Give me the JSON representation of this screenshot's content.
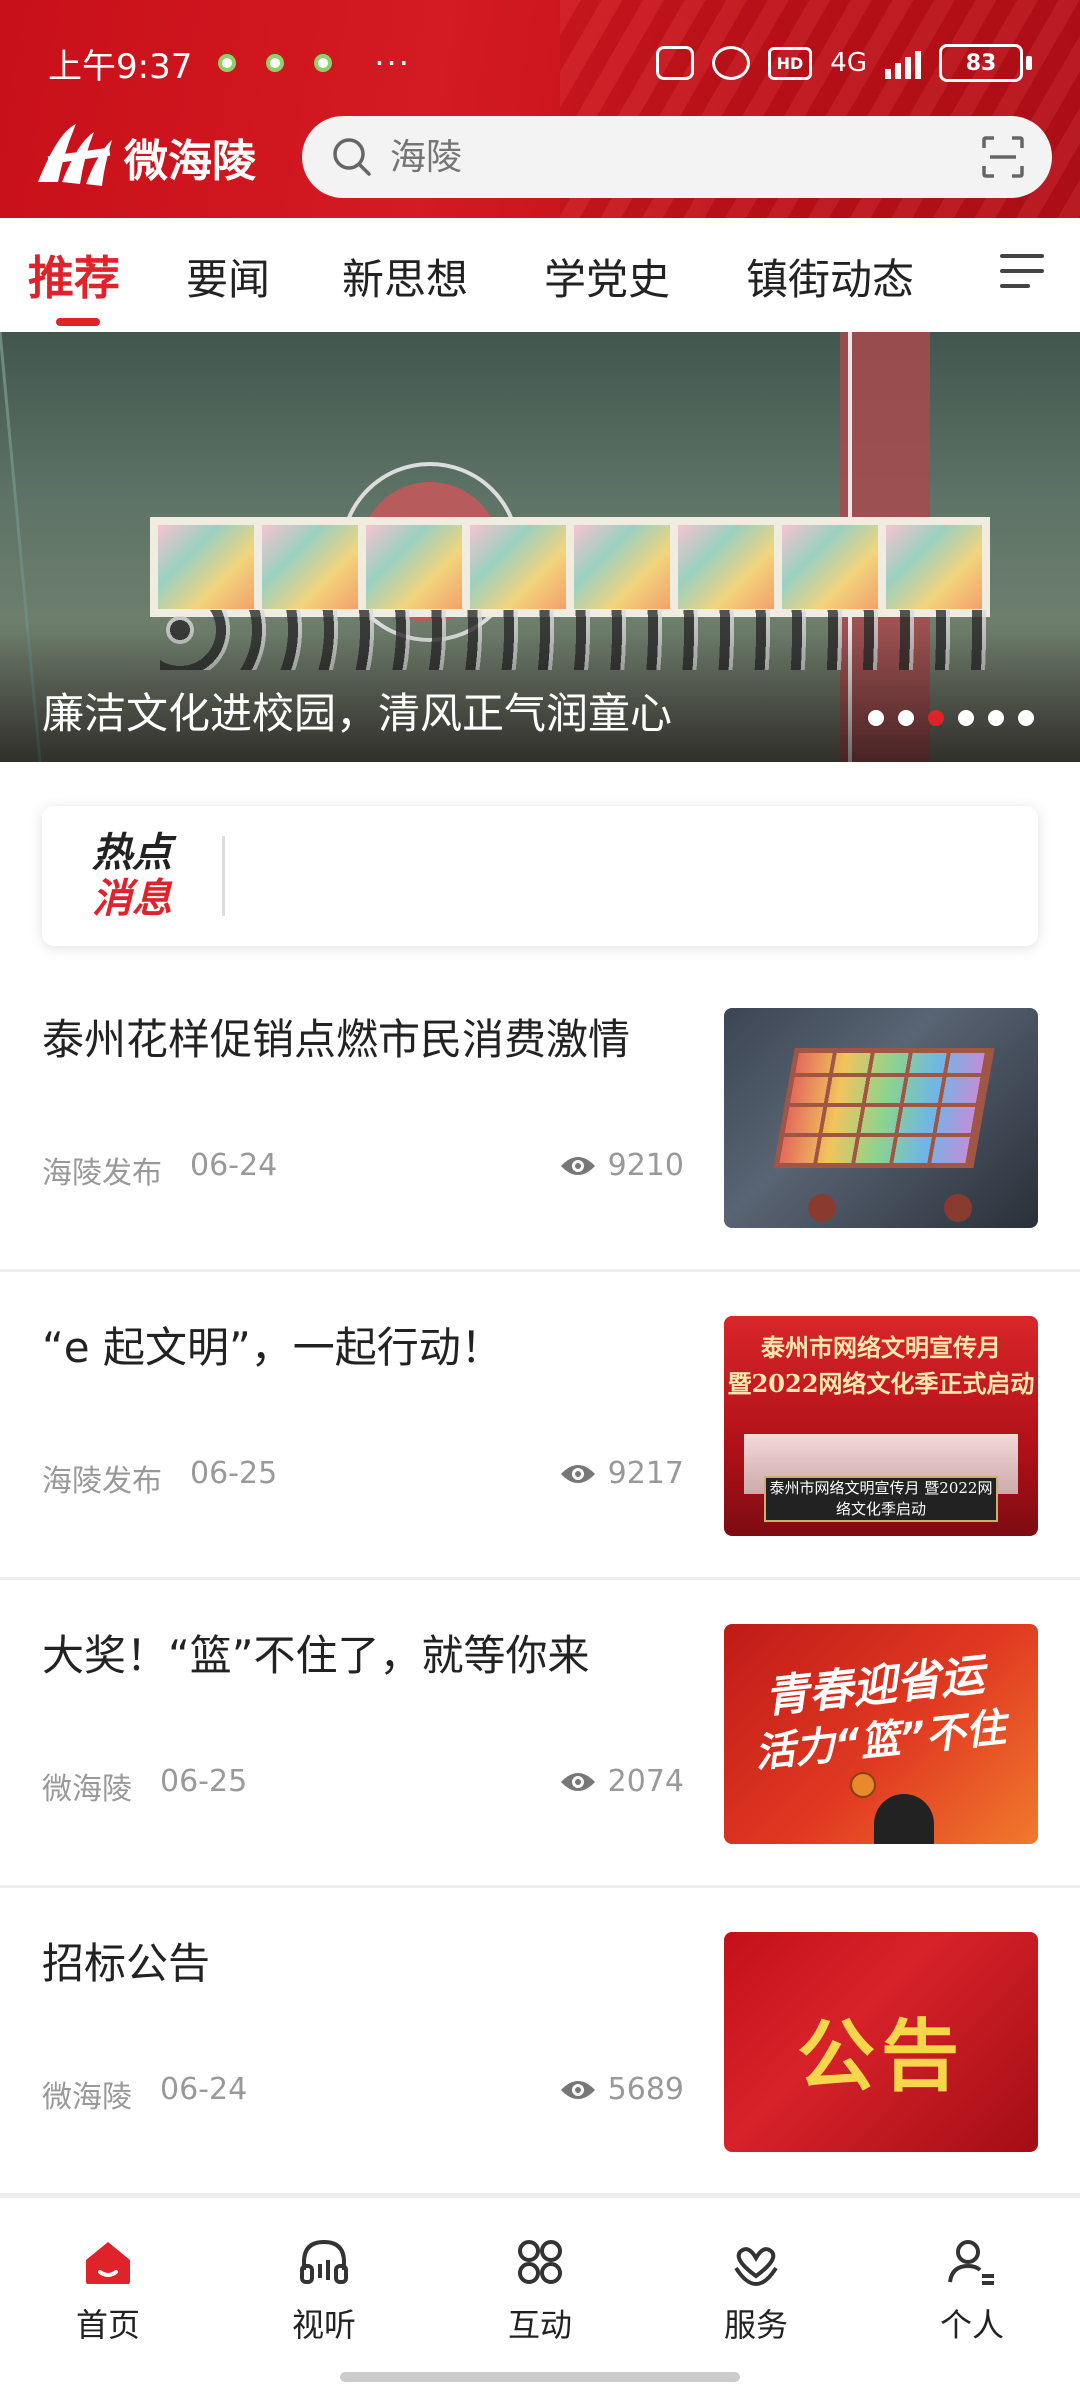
{
  "status": {
    "time": "上午9:37",
    "more": "···",
    "hd": "HD",
    "network": "4G",
    "battery": "83"
  },
  "header": {
    "app_name": "微海陵",
    "search_placeholder": "海陵"
  },
  "tabs": [
    {
      "label": "推荐",
      "active": true
    },
    {
      "label": "要闻"
    },
    {
      "label": "新思想"
    },
    {
      "label": "学党史"
    },
    {
      "label": "镇街动态"
    }
  ],
  "banner": {
    "caption": "廉洁文化进校园，清风正气润童心",
    "slide_count": 6,
    "active_slide": 3
  },
  "hot": {
    "line1": "热点",
    "line2": "消息"
  },
  "news": [
    {
      "title": "泰州花样促销点燃市民消费激情",
      "source": "海陵发布",
      "date": "06-24",
      "views": "9210"
    },
    {
      "title": "“e 起文明”，一起行动！",
      "source": "海陵发布",
      "date": "06-25",
      "views": "9217"
    },
    {
      "title": "大奖！“篮”不住了，就等你来",
      "source": "微海陵",
      "date": "06-25",
      "views": "2074"
    },
    {
      "title": "招标公告",
      "source": "微海陵",
      "date": "06-24",
      "views": "5689"
    }
  ],
  "thumbs": {
    "t2_line1": "泰州市网络文明宣传月",
    "t2_line2": "暨2022网络文化季正式启动",
    "t2_sign": "泰州市网络文明宣传月 暨2022网络文化季启动",
    "t3_line1": "青春迎省运",
    "t3_line2": "活力“篮”不住",
    "t4_text": "公告"
  },
  "bottom_nav": [
    {
      "label": "首页",
      "icon": "home-icon",
      "active": true
    },
    {
      "label": "视听",
      "icon": "headphones-icon"
    },
    {
      "label": "互动",
      "icon": "grid-icon"
    },
    {
      "label": "服务",
      "icon": "heart-hands-icon"
    },
    {
      "label": "个人",
      "icon": "person-icon"
    }
  ],
  "colors": {
    "brand_red": "#e0222a",
    "header_red": "#c8101a"
  }
}
